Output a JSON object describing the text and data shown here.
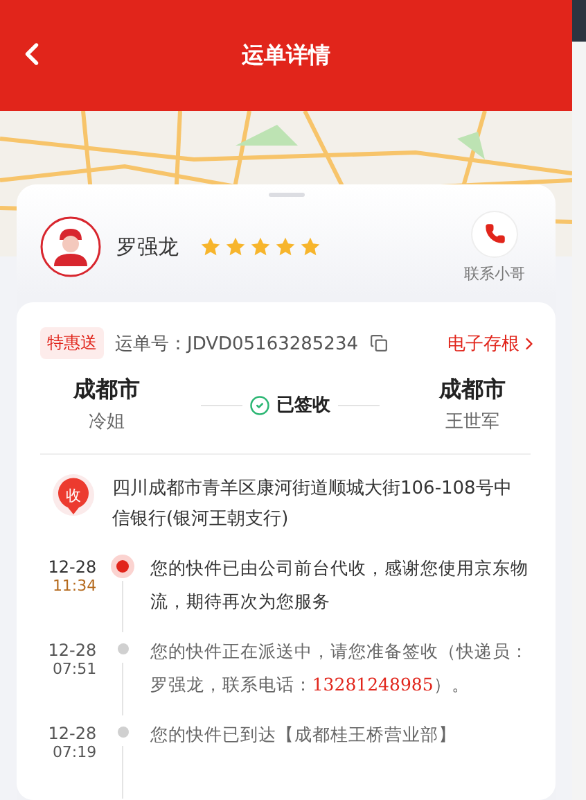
{
  "header": {
    "title": "运单详情"
  },
  "courier": {
    "name": "罗强龙",
    "stars": 5,
    "contact_label": "联系小哥"
  },
  "waybill": {
    "tag": "特惠送",
    "number": "运单号：JDVD05163285234",
    "stub_link": "电子存根"
  },
  "route": {
    "from_city": "成都市",
    "from_name": "冷姐",
    "status": "已签收",
    "to_city": "成都市",
    "to_name": "王世军"
  },
  "address": {
    "badge": "收",
    "text": "四川成都市青羊区康河街道顺城大街106-108号中信银行(银河王朝支行)"
  },
  "timeline": [
    {
      "date": "12-28",
      "time": "11:34",
      "active": true,
      "parts": [
        {
          "kind": "plain",
          "text": "您的快件已由公司前台代收，感谢您使用京东物流，期待再次为您服务"
        }
      ]
    },
    {
      "date": "12-28",
      "time": "07:51",
      "active": false,
      "parts": [
        {
          "kind": "plain",
          "text": "您的快件正在派送中，请您准备签收（快递员：罗强龙，联系电话："
        },
        {
          "kind": "phone",
          "text": "13281248985"
        },
        {
          "kind": "plain",
          "text": "）。"
        }
      ]
    },
    {
      "date": "12-28",
      "time": "07:19",
      "active": false,
      "parts": [
        {
          "kind": "plain",
          "text": "您的快件已到达【成都桂王桥营业部】"
        }
      ]
    }
  ]
}
